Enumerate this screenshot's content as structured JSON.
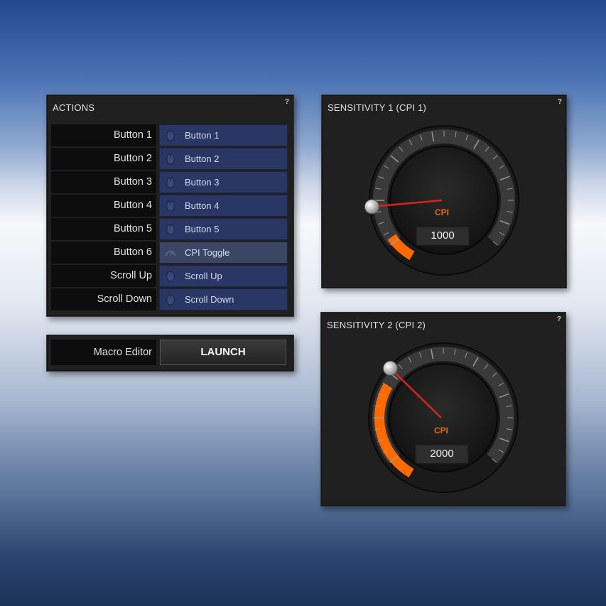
{
  "actions": {
    "title": "ACTIONS",
    "help": "?",
    "rows": [
      {
        "button": "Button 1",
        "action": "Button 1"
      },
      {
        "button": "Button 2",
        "action": "Button 2"
      },
      {
        "button": "Button 3",
        "action": "Button 3"
      },
      {
        "button": "Button 4",
        "action": "Button 4"
      },
      {
        "button": "Button 5",
        "action": "Button 5"
      },
      {
        "button": "Button 6",
        "action": "CPI Toggle"
      },
      {
        "button": "Scroll Up",
        "action": "Scroll Up"
      },
      {
        "button": "Scroll Down",
        "action": "Scroll Down"
      }
    ]
  },
  "macro": {
    "label": "Macro Editor",
    "button": "LAUNCH"
  },
  "sensitivity1": {
    "title": "SENSITIVITY 1 (CPI 1)",
    "help": "?",
    "unit": "CPI",
    "value": "1000"
  },
  "sensitivity2": {
    "title": "SENSITIVITY 2 (CPI 2)",
    "help": "?",
    "unit": "CPI",
    "value": "2000"
  },
  "colors": {
    "accent": "#ff6a00",
    "action_bg": "#2a3663",
    "panel_bg": "#202020"
  },
  "icons": {
    "mouse": "mouse-icon",
    "cpi_toggle": "cpi-toggle-icon"
  }
}
